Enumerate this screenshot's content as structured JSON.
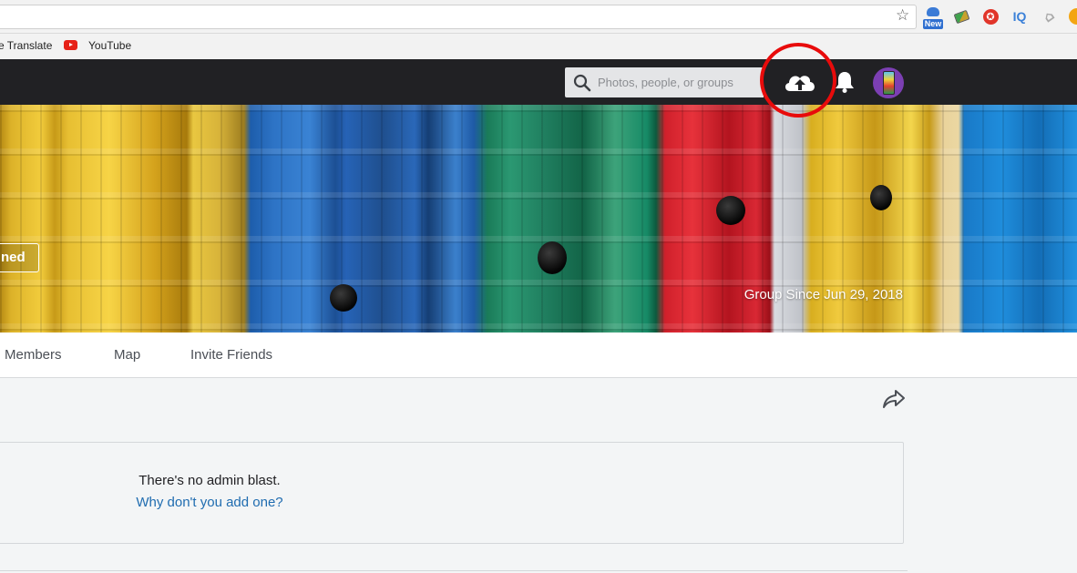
{
  "browser": {
    "bookmarks": [
      {
        "label": "e Translate"
      },
      {
        "label": "YouTube"
      }
    ],
    "extensions": {
      "new_badge": "New",
      "iq_label": "IQ",
      "red_icon_glyph": "✪"
    }
  },
  "header": {
    "search": {
      "placeholder": "Photos, people, or groups"
    },
    "icons": [
      "search-icon",
      "upload-cloud-icon",
      "bell-icon",
      "avatar"
    ],
    "highlight_color": "#e80b0b"
  },
  "cover": {
    "joined_label": "ned",
    "group_since": "Group Since Jun 29, 2018"
  },
  "tabs": [
    {
      "label": "Members"
    },
    {
      "label": "Map"
    },
    {
      "label": "Invite Friends"
    }
  ],
  "admin_blast": {
    "message": "There's no admin blast.",
    "link": "Why don't you add one?"
  },
  "colors": {
    "header_bg": "#212124",
    "link": "#1f6cb0",
    "page_bg": "#f3f5f6"
  }
}
